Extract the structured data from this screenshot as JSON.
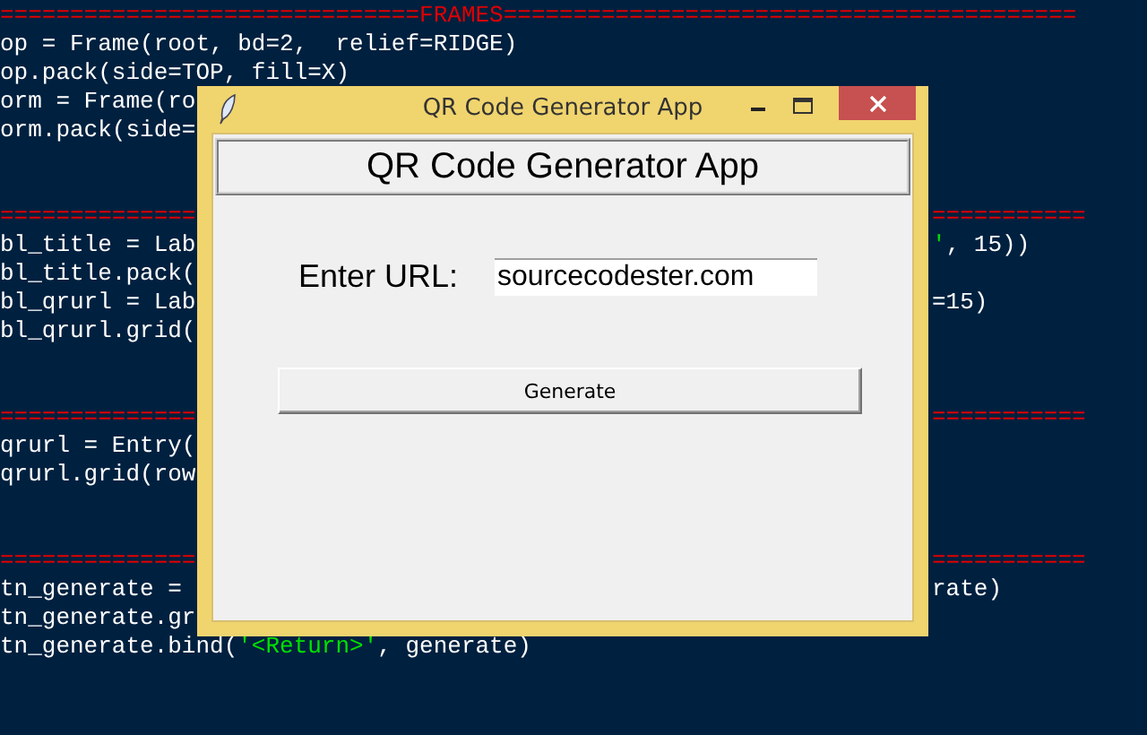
{
  "editor": {
    "blocks": [
      {
        "lines": [
          {
            "left": [
              {
                "kind": "separator",
                "text": "==============================FRAMES========================================="
              }
            ]
          },
          {
            "left": [
              {
                "kind": "code",
                "text": "op = Frame(root, bd=2,  relief=RIDGE)"
              }
            ]
          },
          {
            "left": [
              {
                "kind": "code",
                "text": "op.pack(side=TOP, fill=X)"
              }
            ]
          },
          {
            "left": [
              {
                "kind": "code",
                "text": "orm = Frame(ro"
              }
            ]
          },
          {
            "left": [
              {
                "kind": "code",
                "text": "orm.pack(side="
              }
            ]
          }
        ]
      },
      {
        "lines": [
          {
            "left": [
              {
                "kind": "separator",
                "text": "=============="
              }
            ],
            "right": [
              {
                "kind": "separator",
                "text": "==========="
              }
            ]
          },
          {
            "left": [
              {
                "kind": "code",
                "text": "bl_title = Lab"
              }
            ],
            "right": [
              {
                "kind": "string",
                "text": "'"
              },
              {
                "kind": "code",
                "text": ", 15))"
              }
            ]
          },
          {
            "left": [
              {
                "kind": "code",
                "text": "bl_title.pack("
              }
            ]
          },
          {
            "left": [
              {
                "kind": "code",
                "text": "bl_qrurl = Lab"
              }
            ],
            "right": [
              {
                "kind": "code",
                "text": "=15)"
              }
            ]
          },
          {
            "left": [
              {
                "kind": "code",
                "text": "bl_qrurl.grid("
              }
            ]
          }
        ]
      },
      {
        "lines": [
          {
            "left": [
              {
                "kind": "separator",
                "text": "=============="
              }
            ],
            "right": [
              {
                "kind": "separator",
                "text": "==========="
              }
            ]
          },
          {
            "left": [
              {
                "kind": "code",
                "text": "qrurl = Entry("
              }
            ]
          },
          {
            "left": [
              {
                "kind": "code",
                "text": "qrurl.grid(row"
              }
            ]
          }
        ]
      },
      {
        "lines": [
          {
            "left": [
              {
                "kind": "separator",
                "text": "=============="
              }
            ],
            "right": [
              {
                "kind": "separator",
                "text": "==========="
              }
            ]
          },
          {
            "left": [
              {
                "kind": "code",
                "text": "tn_generate ="
              }
            ],
            "right": [
              {
                "kind": "code",
                "text": "rate)"
              }
            ]
          },
          {
            "left": [
              {
                "kind": "code",
                "text": "tn_generate.gr"
              }
            ]
          },
          {
            "left": [
              {
                "kind": "code",
                "text": "tn_generate.bind("
              },
              {
                "kind": "string",
                "text": "'<Return>'"
              },
              {
                "kind": "code",
                "text": ", generate)"
              }
            ]
          }
        ]
      }
    ]
  },
  "window": {
    "title": "QR Code Generator App",
    "heading": "QR Code Generator App",
    "url_label": "Enter URL:",
    "url_field": {
      "value": "sourcecodester.com"
    },
    "button": "Generate"
  }
}
